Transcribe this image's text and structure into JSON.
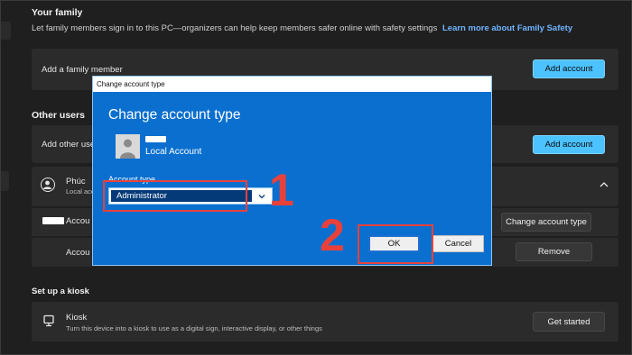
{
  "family": {
    "title": "Your family",
    "description": "Let family members sign in to this PC—organizers can help keep members safer online with safety settings",
    "link": "Learn more about Family Safety",
    "add_member_label": "Add a family member",
    "add_account_button": "Add account"
  },
  "other_users": {
    "title": "Other users",
    "add_other_label": "Add other use",
    "add_account_button": "Add account",
    "user_name": "Phúc",
    "user_sub": "Local acco",
    "account_options_label": "Accou",
    "account_data_label": "Accou",
    "change_type_button": "Change account type",
    "remove_button": "Remove",
    "expand_icon": "chevron-up-icon"
  },
  "kiosk": {
    "title": "Set up a kiosk",
    "label": "Kiosk",
    "description": "Turn this device into a kiosk to use as a digital sign, interactive display, or other things",
    "button": "Get started"
  },
  "dialog": {
    "window_title": "Change account type",
    "heading": "Change account type",
    "account_kind": "Local Account",
    "type_label": "Account type",
    "selected_type": "Administrator",
    "ok_button": "OK",
    "cancel_button": "Cancel"
  },
  "annotations": {
    "step1": "1",
    "step2": "2"
  },
  "colors": {
    "accent_button": "#4cc2ff",
    "dialog_blue": "#0a6fcf",
    "annotation_red": "#e8413b"
  }
}
